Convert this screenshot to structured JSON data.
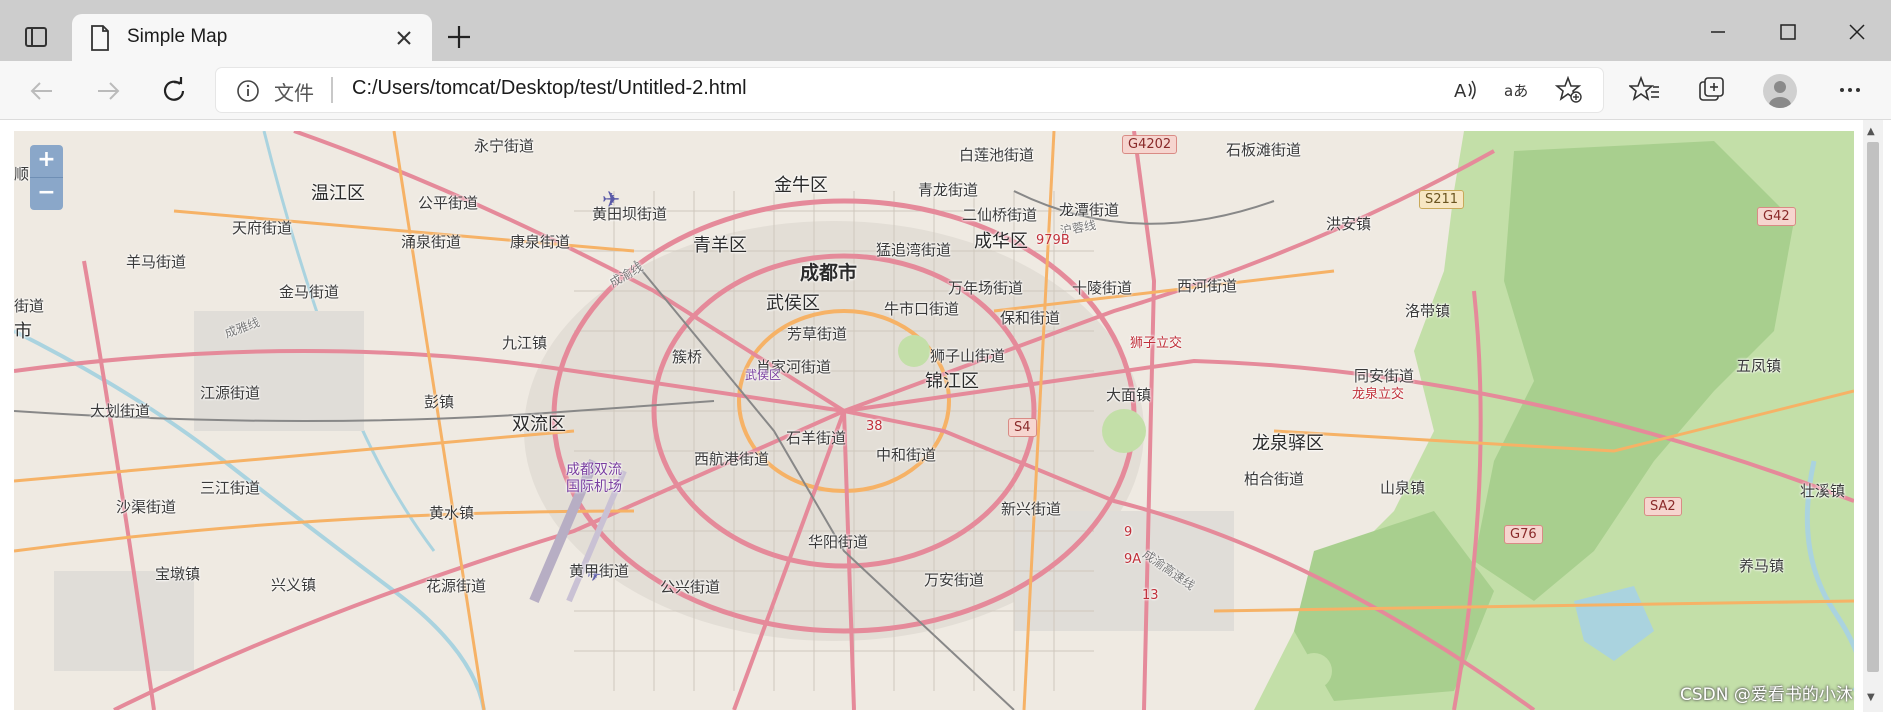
{
  "tab": {
    "title": "Simple Map"
  },
  "address_bar": {
    "security_label": "文件",
    "url": "C:/Users/tomcat/Desktop/test/Untitled-2.html"
  },
  "map": {
    "zoom_in": "+",
    "zoom_out": "−",
    "labels": {
      "chengdu": "成都市",
      "jinniu": "金牛区",
      "qingyang": "青羊区",
      "chenghua": "成华区",
      "wuhou": "武侯区",
      "jinjiang": "锦江区",
      "wenjiang": "温江区",
      "shuangliu": "双流区",
      "longquanyi": "龙泉驿区",
      "yongfeng": "永宁街道",
      "bailian": "白莲池街道",
      "shibantan": "石板滩街道",
      "qinglong": "青龙街道",
      "erxian": "二仙桥街道",
      "longtan": "龙潭街道",
      "hongan": "洪安镇",
      "huangtian": "黄田坝街道",
      "gongping": "公平街道",
      "tianfu": "天府街道",
      "yongquan": "涌泉街道",
      "kangquan": "康泉街道",
      "mengzhui": "猛追湾街道",
      "yangma": "羊马街道",
      "jinma": "金马街道",
      "wannian": "万年场街道",
      "shiling": "十陵街道",
      "xihe": "西河街道",
      "luodai": "洛带镇",
      "niushikou": "牛市口街道",
      "baohe": "保和街道",
      "fangcao": "芳草街道",
      "jiujiang": "九江镇",
      "cuqiao": "簇桥",
      "xiaojiahe": "肖家河街道",
      "shizishan": "狮子山街道",
      "tongan": "同安街道",
      "wufeng": "五凤镇",
      "dahua": "大划街道",
      "jiangyuan": "江源街道",
      "pengzhen": "彭镇",
      "damian": "大面镇",
      "shiyang": "石羊街道",
      "zhonghe": "中和街道",
      "xihang": "西航港街道",
      "sanjiang": "三江街道",
      "baihe": "柏合街道",
      "shanquan": "山泉镇",
      "shaqu": "沙渠街道",
      "huangshui": "黄水镇",
      "xinxing": "新兴街道",
      "huayang": "华阳街道",
      "zhuangtian": "壮溪镇",
      "baodun": "宝墩镇",
      "xingyi": "兴义镇",
      "huayuan": "花源街道",
      "huangjia": "黄甲街道",
      "gongxing": "公兴街道",
      "wanan": "万安街道",
      "yangma2": "养马镇",
      "airport": "成都双流\n国际机场",
      "shizi_interchange": "狮子立交",
      "longquan_interchange": "龙泉立交",
      "wuhou_small": "武侯区",
      "left_edge_1": "顺家镇",
      "left_edge_2": "街道",
      "left_edge_3": "市",
      "chengya": "成雅线",
      "chengyu": "成渝线",
      "mengling": "沪蓉线",
      "chengzi": "成渝高速线"
    },
    "shields": {
      "g4202": "G4202",
      "s211": "S211",
      "g42": "G42",
      "s4": "S4",
      "g76": "G76",
      "sa2": "SA2",
      "n38": "38",
      "n979b": "979B",
      "n9": "9",
      "n9a": "9A",
      "n13": "13"
    }
  },
  "watermark": "CSDN @爱看书的小沐",
  "colors": {
    "map_background": "#efeae2",
    "major_road": "#e58a9a",
    "secondary_road": "#f6b266",
    "forest": "#a8cf8e",
    "water": "#aad3df"
  }
}
